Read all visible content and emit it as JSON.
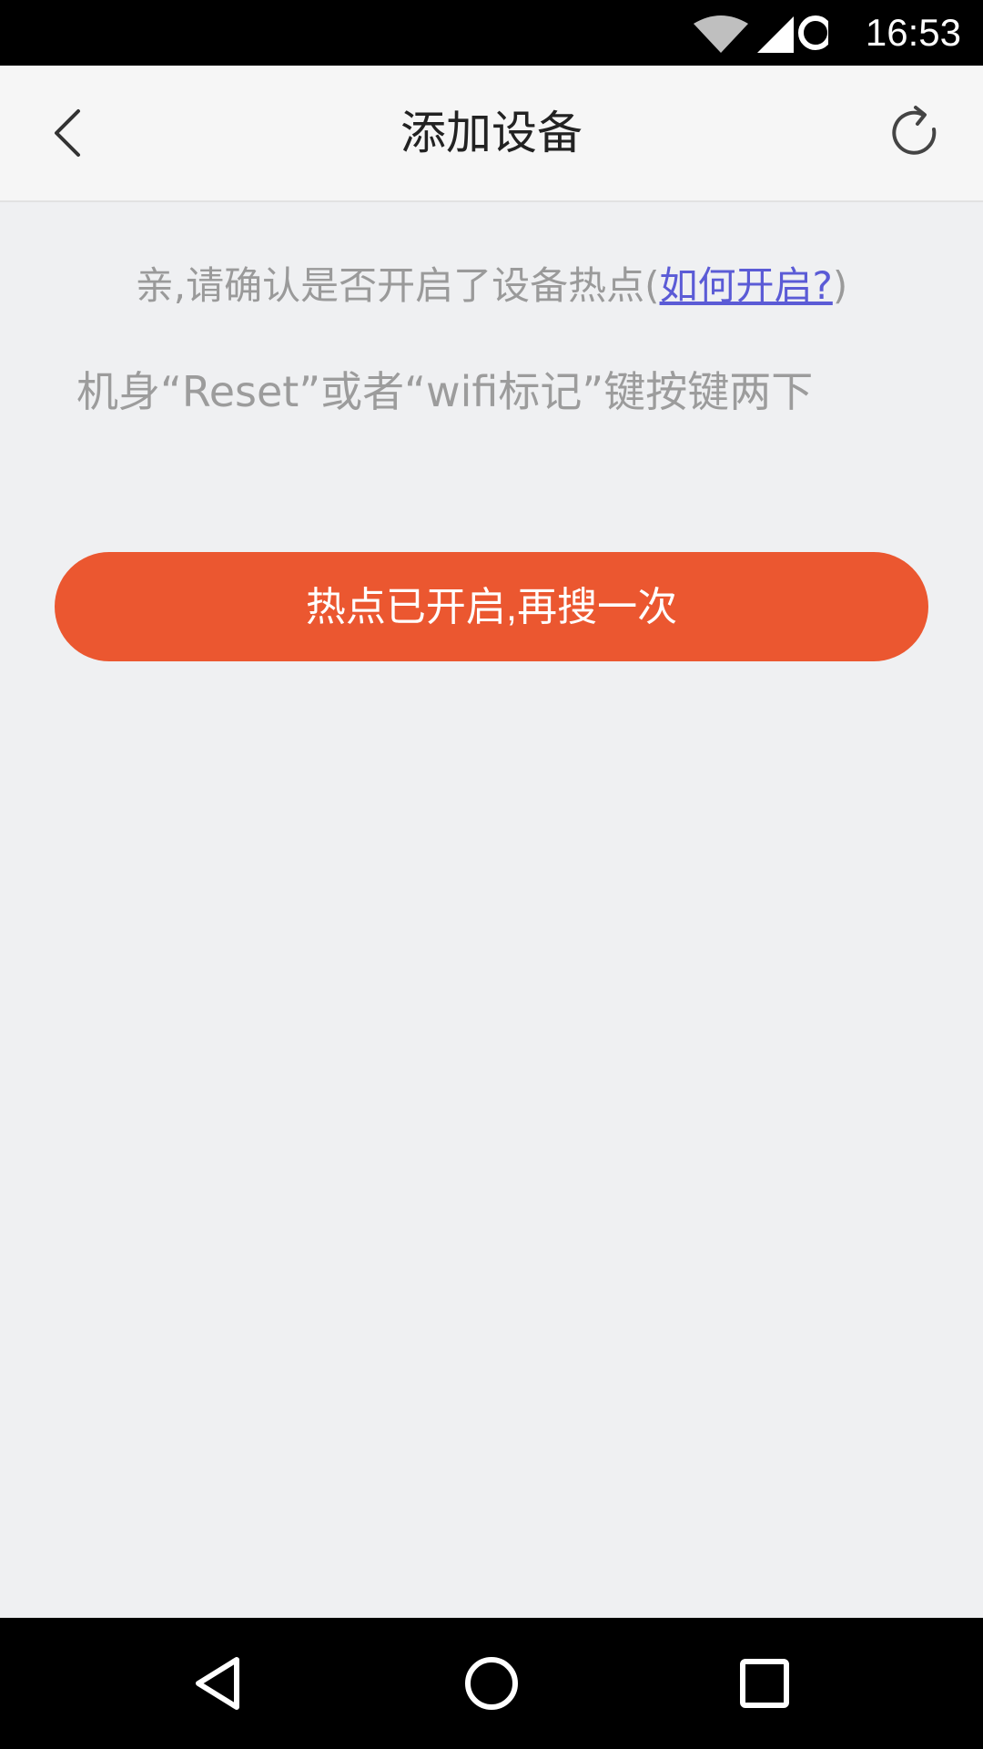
{
  "status_bar": {
    "time": "16:53",
    "icons": [
      "wifi-icon",
      "cell-signal-icon",
      "loading-icon"
    ],
    "background": "#000000"
  },
  "header": {
    "title": "添加设备",
    "back_icon": "chevron-left-icon",
    "refresh_icon": "refresh-icon"
  },
  "main": {
    "confirm_prefix": "亲,请确认是否开启了设备热点(",
    "howto_link": "如何开启?",
    "confirm_suffix": ")",
    "instruction": "机身“Reset”或者“wifi标记”键按键两下",
    "retry_button": "热点已开启,再搜一次"
  },
  "nav_bar": {
    "back": "nav-back-icon",
    "home": "nav-home-icon",
    "recents": "nav-recents-icon"
  },
  "colors": {
    "accent": "#eb5730",
    "link": "#5b5bd6",
    "background": "#eff0f2",
    "header_bg": "#f6f6f6"
  }
}
